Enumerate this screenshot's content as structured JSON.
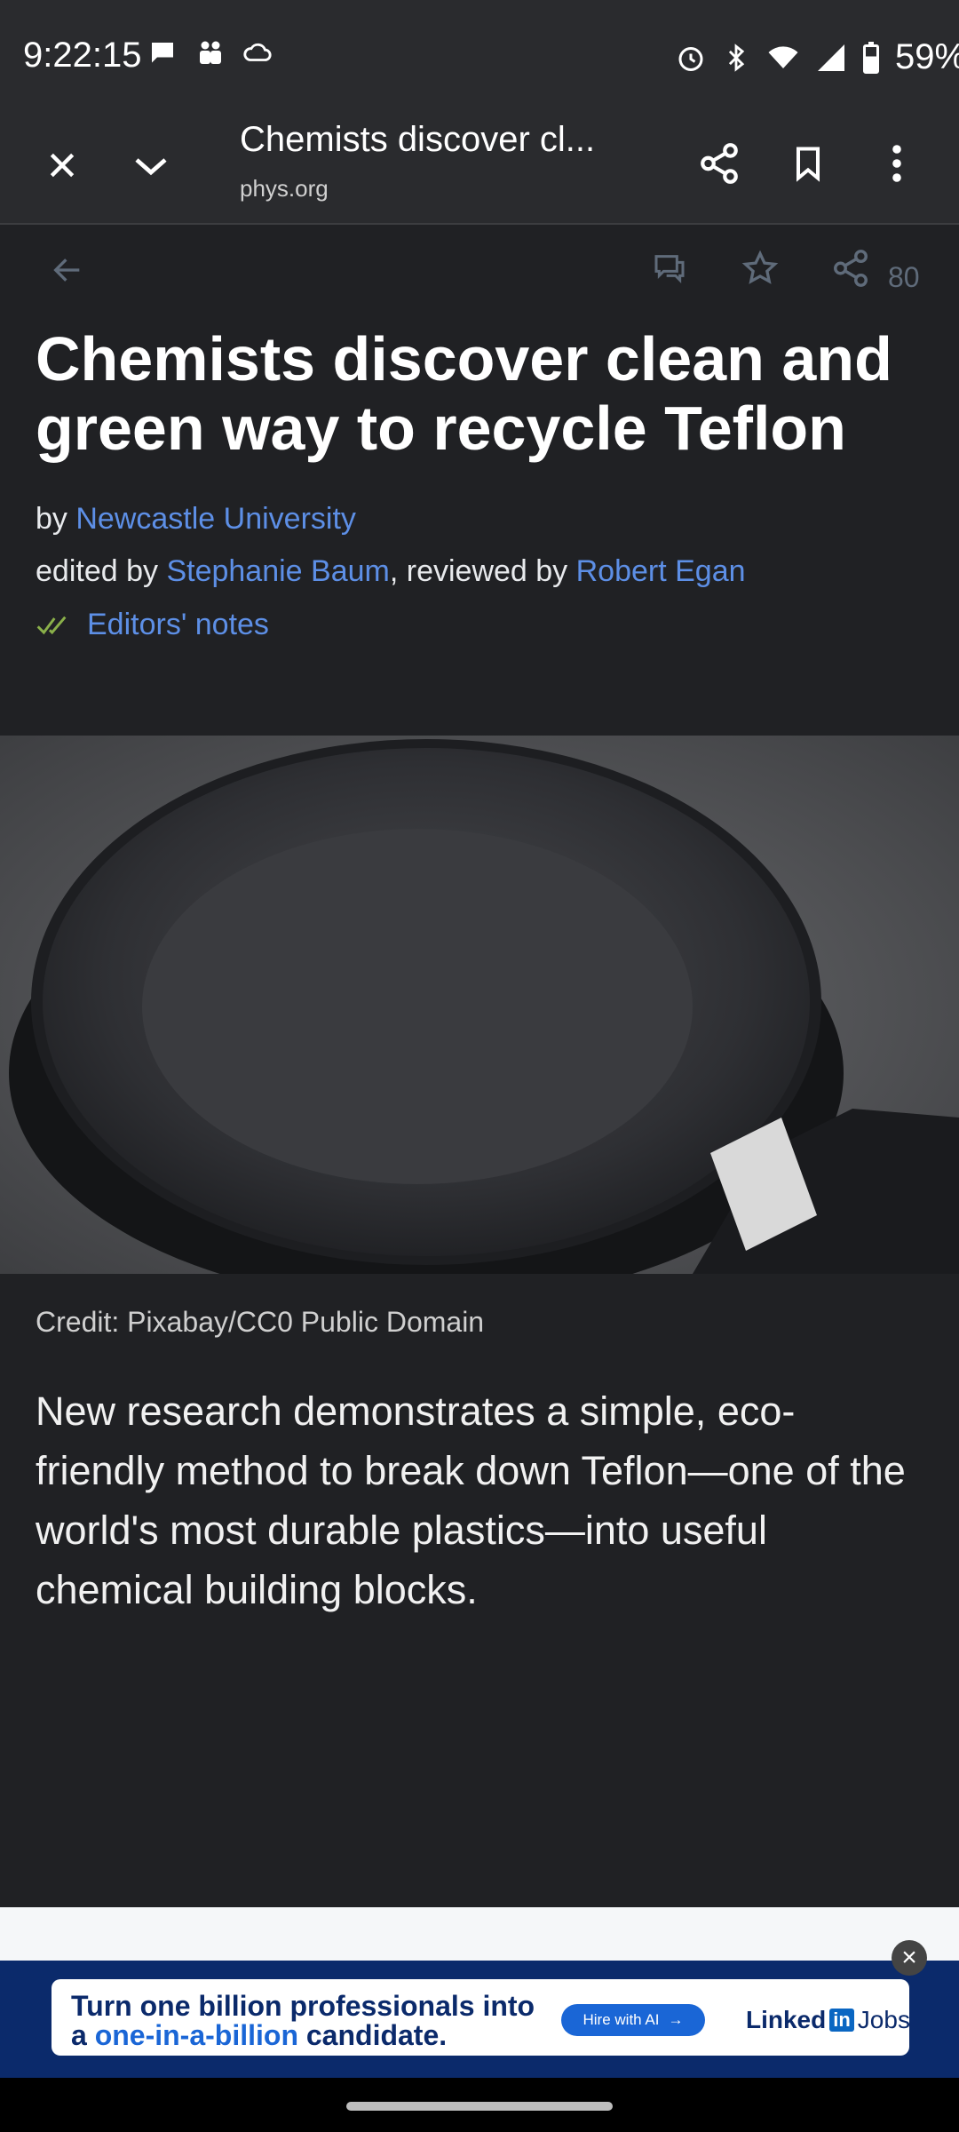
{
  "status": {
    "time": "9:22:15",
    "battery": "59%"
  },
  "toolbar": {
    "title": "Chemists discover cl...",
    "url": "phys.org"
  },
  "article": {
    "share_count": "80",
    "headline": "Chemists discover clean and green way to recycle Teflon",
    "byline_prefix": "by ",
    "author": "Newcastle University",
    "edited_prefix": "edited by ",
    "editor": "Stephanie Baum",
    "reviewed_prefix": ", reviewed by ",
    "reviewer": "Robert Egan",
    "editors_notes": "Editors' notes",
    "image_credit": "Credit: Pixabay/CC0 Public Domain",
    "lead": "New research demonstrates a simple, eco-friendly method to break down Teflon—one of the world's most durable plastics—into useful chemical building blocks."
  },
  "ad": {
    "line1": "Turn one billion professionals into",
    "line2_prefix": "a ",
    "line2_accent": "one-in-a-billion",
    "line2_suffix": " candidate.",
    "cta": "Hire with AI",
    "brand_text": "Linked",
    "brand_box": "in",
    "brand_suffix": " Jobs"
  },
  "colors": {
    "background": "#202124",
    "link": "#5d8fe6",
    "check": "#8ab04a"
  }
}
